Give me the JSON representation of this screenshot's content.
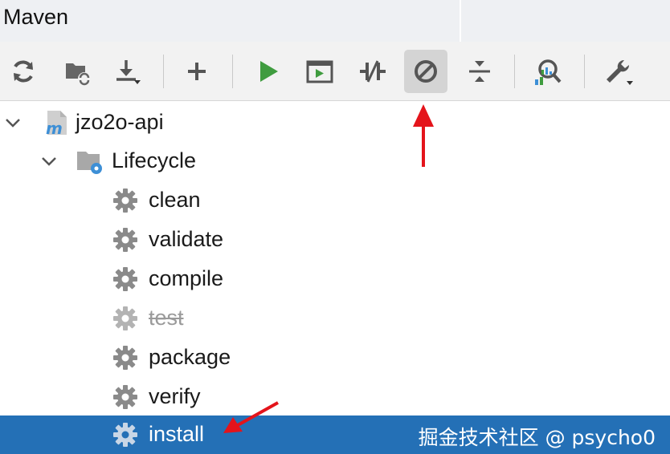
{
  "window": {
    "title": "Maven"
  },
  "toolbar": {
    "buttons": [
      {
        "name": "reload-all-projects",
        "icon": "refresh-icon"
      },
      {
        "name": "generate-sources",
        "icon": "folder-refresh-icon"
      },
      {
        "name": "download-sources",
        "icon": "download-icon"
      },
      {
        "name": "add-maven-project",
        "icon": "plus-icon"
      },
      {
        "name": "run-maven-build",
        "icon": "run-icon"
      },
      {
        "name": "execute-maven-goal",
        "icon": "terminal-icon"
      },
      {
        "name": "toggle-offline-mode",
        "icon": "offline-icon"
      },
      {
        "name": "skip-tests",
        "icon": "skip-icon",
        "active": true
      },
      {
        "name": "collapse-all",
        "icon": "collapse-icon"
      },
      {
        "name": "analyze-dependencies",
        "icon": "analyze-icon"
      },
      {
        "name": "maven-settings",
        "icon": "wrench-icon"
      }
    ]
  },
  "tree": {
    "project": {
      "label": "jzo2o-api",
      "icon": "maven-module-icon"
    },
    "lifecycle": {
      "label": "Lifecycle",
      "icon": "folder-gear-icon"
    },
    "goals": [
      {
        "label": "clean",
        "icon": "gear-icon",
        "disabled": false,
        "selected": false
      },
      {
        "label": "validate",
        "icon": "gear-icon",
        "disabled": false,
        "selected": false
      },
      {
        "label": "compile",
        "icon": "gear-icon",
        "disabled": false,
        "selected": false
      },
      {
        "label": "test",
        "icon": "gear-icon",
        "disabled": true,
        "selected": false
      },
      {
        "label": "package",
        "icon": "gear-icon",
        "disabled": false,
        "selected": false
      },
      {
        "label": "verify",
        "icon": "gear-icon",
        "disabled": false,
        "selected": false
      },
      {
        "label": "install",
        "icon": "gear-icon",
        "disabled": false,
        "selected": true
      }
    ]
  },
  "watermark": "掘金技术社区 @ psycho0",
  "colors": {
    "selection": "#2470b6",
    "run_green": "#3f9c3f",
    "arrow_red": "#e4141b",
    "maven_blue": "#3d8fd6"
  }
}
